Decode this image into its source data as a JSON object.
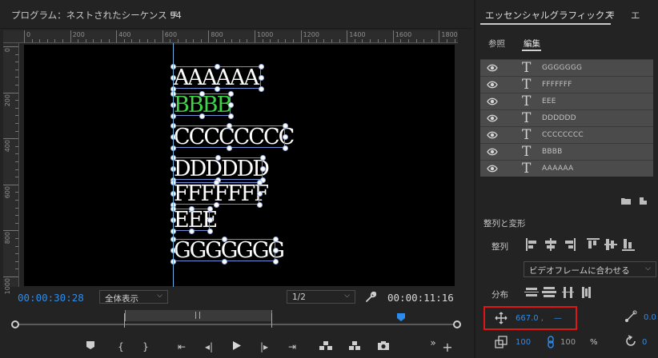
{
  "program": {
    "title": "プログラム：ネストされたシーケンス 94",
    "menu_icon": "≡",
    "ruler_top_labels": [
      "0",
      "200",
      "400",
      "600",
      "800",
      "1000",
      "1200",
      "1400",
      "1600",
      "1800"
    ],
    "ruler_left_labels": [
      "0",
      "200",
      "400",
      "600",
      "800",
      "1000"
    ],
    "text_layers": [
      {
        "text": "AAAAAA",
        "color": "#ffffff"
      },
      {
        "text": "BBBB",
        "color": "#3fd24a"
      },
      {
        "text": "CCCCCCCC",
        "color": "#ffffff"
      },
      {
        "text": "DDDDDD",
        "color": "#ffffff"
      },
      {
        "text": "FFFFFFF",
        "color": "#ffffff"
      },
      {
        "text": "EEE",
        "color": "#ffffff"
      },
      {
        "text": "GGGGGGG",
        "color": "#ffffff"
      }
    ]
  },
  "transport": {
    "current_timecode": "00:00:30:28",
    "zoom_select": "全体表示",
    "resolution_select": "1/2",
    "duration_timecode": "00:00:11:16",
    "wrench_icon": "wrench-icon",
    "buttons": [
      "marker",
      "in",
      "out",
      "go-to-in",
      "step-back",
      "play",
      "step-forward",
      "go-to-out",
      "lift",
      "extract",
      "export-frame"
    ],
    "more_icon": "»",
    "add_icon": "+"
  },
  "essential_graphics": {
    "tab_label": "エッセンシャルグラフィックス",
    "menu_icon": "≡",
    "tab2_label": "エ",
    "subtab_browse": "参照",
    "subtab_edit": "編集",
    "layers": [
      "GGGGGGG",
      "FFFFFFF",
      "EEE",
      "DDDDDD",
      "CCCCCCCC",
      "BBBB",
      "AAAAAA"
    ],
    "align_section_title": "整列と変形",
    "align_label": "整列",
    "align_to_select": "ビデオフレームに合わせる",
    "distribute_label": "分布",
    "position_value": "667.0 ,",
    "position_value2": "—",
    "anchor_value": "0.0",
    "scale_value": "100",
    "scale_value2": "100",
    "percent": "%",
    "rotation_value": "0",
    "accent_color": "#2d8ceb",
    "highlight_color": "#e01515"
  }
}
